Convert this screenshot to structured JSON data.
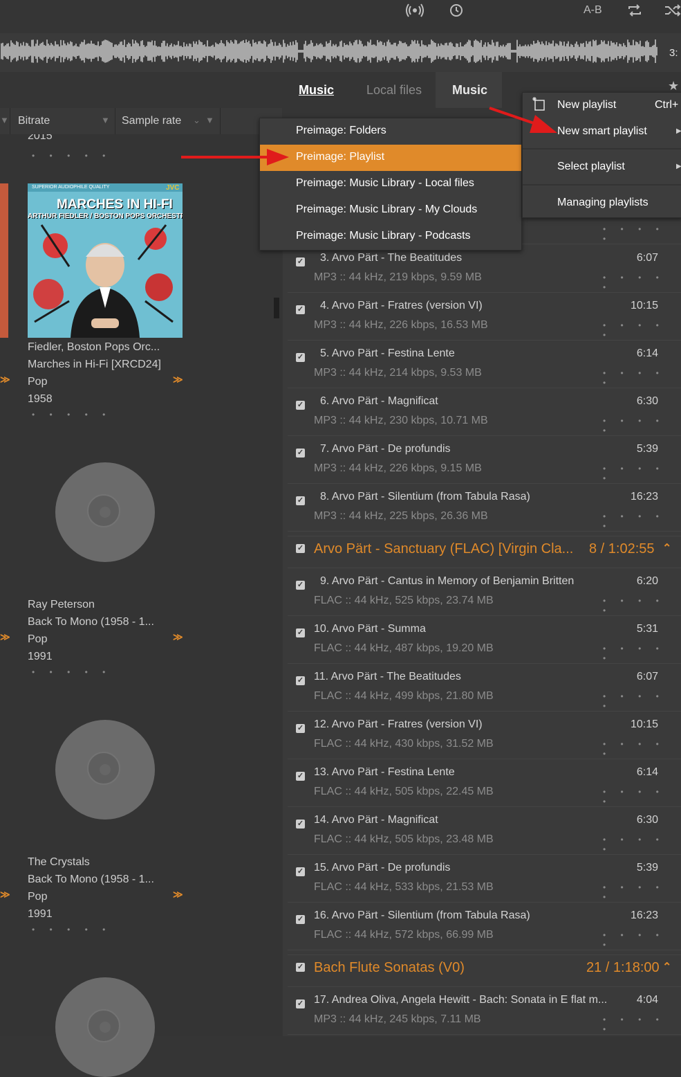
{
  "toolbar": {
    "ab_label": "A-B",
    "time": "3:",
    "icons": [
      "broadcast-icon",
      "timer-icon",
      "repeat-icon",
      "shuffle-icon"
    ]
  },
  "tabs": [
    {
      "label": "Music",
      "state": "underlined"
    },
    {
      "label": "Local files",
      "state": "inactive"
    },
    {
      "label": "Music",
      "state": "active"
    }
  ],
  "columns": {
    "bitrate": "Bitrate",
    "sample_rate": "Sample rate"
  },
  "albums": [
    {
      "year": "2015"
    },
    {
      "art_title": "MARCHES IN HI-FI",
      "art_subtitle": "ARTHUR FIEDLER / BOSTON POPS ORCHESTRA",
      "art_top": "SUPERIOR AUDIOPHILE QUALITY",
      "art_brand": "JVC",
      "artist": "Fiedler, Boston Pops Orc...",
      "album": "Marches in Hi-Fi [XRCD24]",
      "genre": "Pop",
      "year": "1958"
    },
    {
      "artist": "Ray Peterson",
      "album": "Back To Mono (1958 - 1...",
      "genre": "Pop",
      "year": "1991"
    },
    {
      "artist": "The Crystals",
      "album": "Back To Mono (1958 - 1...",
      "genre": "Pop",
      "year": "1991"
    }
  ],
  "preimage_menu": [
    {
      "label": "Preimage: Folders",
      "selected": false
    },
    {
      "label": "Preimage: Playlist",
      "selected": true
    },
    {
      "label": "Preimage: Music Library - Local files",
      "selected": false
    },
    {
      "label": "Preimage: Music Library - My Clouds",
      "selected": false
    },
    {
      "label": "Preimage: Music Library - Podcasts",
      "selected": false
    }
  ],
  "playlist_menu": {
    "new_playlist": "New playlist",
    "new_playlist_shortcut": "Ctrl+",
    "new_smart_playlist": "New smart playlist",
    "select_playlist": "Select playlist",
    "managing_playlists": "Managing playlists"
  },
  "tracks_a": [
    {
      "title": "3. Arvo Pärt - The Beatitudes",
      "meta": "MP3 :: 44 kHz, 219 kbps, 9.59 MB",
      "dur": "6:07"
    },
    {
      "title": "4. Arvo Pärt - Fratres (version VI)",
      "meta": "MP3 :: 44 kHz, 226 kbps, 16.53 MB",
      "dur": "10:15"
    },
    {
      "title": "5. Arvo Pärt - Festina Lente",
      "meta": "MP3 :: 44 kHz, 214 kbps, 9.53 MB",
      "dur": "6:14"
    },
    {
      "title": "6. Arvo Pärt - Magnificat",
      "meta": "MP3 :: 44 kHz, 230 kbps, 10.71 MB",
      "dur": "6:30"
    },
    {
      "title": "7. Arvo Pärt - De profundis",
      "meta": "MP3 :: 44 kHz, 226 kbps, 9.15 MB",
      "dur": "5:39"
    },
    {
      "title": "8. Arvo Pärt - Silentium (from Tabula Rasa)",
      "meta": "MP3 :: 44 kHz, 225 kbps, 26.36 MB",
      "dur": "16:23"
    }
  ],
  "group_1": {
    "title": "Arvo Pärt - Sanctuary (FLAC) [Virgin Cla...",
    "summary": "8 / 1:02:55"
  },
  "tracks_b": [
    {
      "title": "9. Arvo Pärt - Cantus in Memory of Benjamin Britten",
      "meta": "FLAC :: 44 kHz, 525 kbps, 23.74 MB",
      "dur": "6:20"
    },
    {
      "title": "10. Arvo Pärt - Summa",
      "meta": "FLAC :: 44 kHz, 487 kbps, 19.20 MB",
      "dur": "5:31"
    },
    {
      "title": "11. Arvo Pärt - The Beatitudes",
      "meta": "FLAC :: 44 kHz, 499 kbps, 21.80 MB",
      "dur": "6:07"
    },
    {
      "title": "12. Arvo Pärt - Fratres (version VI)",
      "meta": "FLAC :: 44 kHz, 430 kbps, 31.52 MB",
      "dur": "10:15"
    },
    {
      "title": "13. Arvo Pärt - Festina Lente",
      "meta": "FLAC :: 44 kHz, 505 kbps, 22.45 MB",
      "dur": "6:14"
    },
    {
      "title": "14. Arvo Pärt - Magnificat",
      "meta": "FLAC :: 44 kHz, 505 kbps, 23.48 MB",
      "dur": "6:30"
    },
    {
      "title": "15. Arvo Pärt - De profundis",
      "meta": "FLAC :: 44 kHz, 533 kbps, 21.53 MB",
      "dur": "5:39"
    },
    {
      "title": "16. Arvo Pärt - Silentium (from Tabula Rasa)",
      "meta": "FLAC :: 44 kHz, 572 kbps, 66.99 MB",
      "dur": "16:23"
    }
  ],
  "group_2": {
    "title": "Bach Flute Sonatas (V0)",
    "summary": "21 / 1:18:00"
  },
  "tracks_c": [
    {
      "title": "17. Andrea Oliva, Angela Hewitt - Bach: Sonata in E flat m...",
      "meta": "MP3 :: 44 kHz, 245 kbps, 7.11 MB",
      "dur": "4:04"
    }
  ],
  "colors": {
    "accent": "#e08a2a",
    "background": "#353535",
    "panel": "#3a3a3a"
  }
}
